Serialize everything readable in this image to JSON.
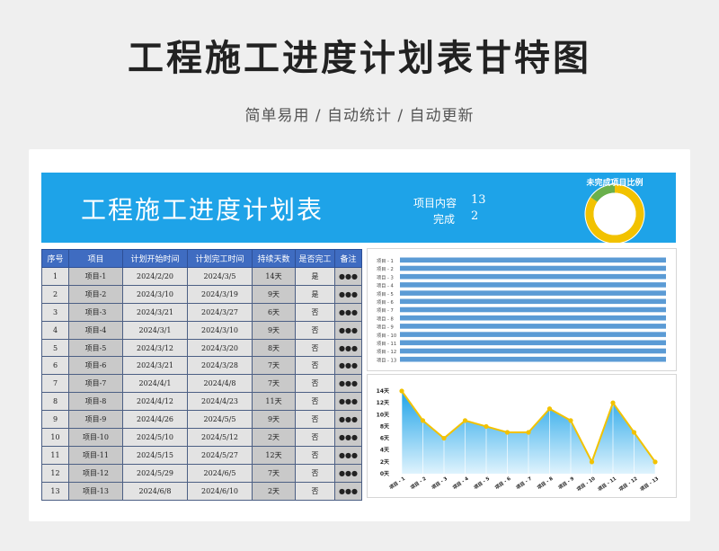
{
  "page": {
    "title": "工程施工进度计划表甘特图",
    "subtitle": "简单易用 / 自动统计 / 自动更新"
  },
  "banner": {
    "title": "工程施工进度计划表",
    "count_label": "项目内容",
    "count_value": "13",
    "done_label": "完成",
    "done_value": "2",
    "donut_title": "未完成项目比例",
    "donut_colors": {
      "incomplete": "#f2c200",
      "complete": "#6ab04c"
    },
    "accent_color": "#1ea3e8"
  },
  "table": {
    "headers": [
      "序号",
      "项目",
      "计划开始时间",
      "计划完工时间",
      "持续天数",
      "是否完工",
      "备注"
    ],
    "rows": [
      [
        "1",
        "项目-1",
        "2024/2/20",
        "2024/3/5",
        "14天",
        "是",
        "●●●"
      ],
      [
        "2",
        "项目-2",
        "2024/3/10",
        "2024/3/19",
        "9天",
        "是",
        "●●●"
      ],
      [
        "3",
        "项目-3",
        "2024/3/21",
        "2024/3/27",
        "6天",
        "否",
        "●●●"
      ],
      [
        "4",
        "项目-4",
        "2024/3/1",
        "2024/3/10",
        "9天",
        "否",
        "●●●"
      ],
      [
        "5",
        "项目-5",
        "2024/3/12",
        "2024/3/20",
        "8天",
        "否",
        "●●●"
      ],
      [
        "6",
        "项目-6",
        "2024/3/21",
        "2024/3/28",
        "7天",
        "否",
        "●●●"
      ],
      [
        "7",
        "项目-7",
        "2024/4/1",
        "2024/4/8",
        "7天",
        "否",
        "●●●"
      ],
      [
        "8",
        "项目-8",
        "2024/4/12",
        "2024/4/23",
        "11天",
        "否",
        "●●●"
      ],
      [
        "9",
        "项目-9",
        "2024/4/26",
        "2024/5/5",
        "9天",
        "否",
        "●●●"
      ],
      [
        "10",
        "项目-10",
        "2024/5/10",
        "2024/5/12",
        "2天",
        "否",
        "●●●"
      ],
      [
        "11",
        "项目-11",
        "2024/5/15",
        "2024/5/27",
        "12天",
        "否",
        "●●●"
      ],
      [
        "12",
        "项目-12",
        "2024/5/29",
        "2024/6/5",
        "7天",
        "否",
        "●●●"
      ],
      [
        "13",
        "项目-13",
        "2024/6/8",
        "2024/6/10",
        "2天",
        "否",
        "●●●"
      ]
    ]
  },
  "chart_data": [
    {
      "type": "bar",
      "categories": [
        "项目 - 1",
        "项目 - 2",
        "项目 - 3",
        "项目 - 4",
        "项目 - 5",
        "项目 - 6",
        "项目 - 7",
        "项目 - 8",
        "项目 - 9",
        "项目 - 10",
        "项目 - 11",
        "项目 - 12",
        "项目 - 13"
      ],
      "color": "#5b9bd5",
      "grid": false
    },
    {
      "type": "area",
      "categories": [
        "项目 - 1",
        "项目 - 2",
        "项目 - 3",
        "项目 - 4",
        "项目 - 5",
        "项目 - 6",
        "项目 - 7",
        "项目 - 8",
        "项目 - 9",
        "项目 - 10",
        "项目 - 11",
        "项目 - 12",
        "项目 - 13"
      ],
      "values": [
        14,
        9,
        6,
        9,
        8,
        7,
        7,
        11,
        9,
        2,
        12,
        7,
        2
      ],
      "ylim": [
        0,
        14
      ],
      "yticks": [
        "0天",
        "2天",
        "4天",
        "6天",
        "8天",
        "10天",
        "12天",
        "14天"
      ],
      "line_color": "#f2c200",
      "fill_color": "#1ea3e8",
      "grid": false
    },
    {
      "type": "pie",
      "categories": [
        "未完成",
        "完成"
      ],
      "values": [
        11,
        2
      ]
    }
  ]
}
